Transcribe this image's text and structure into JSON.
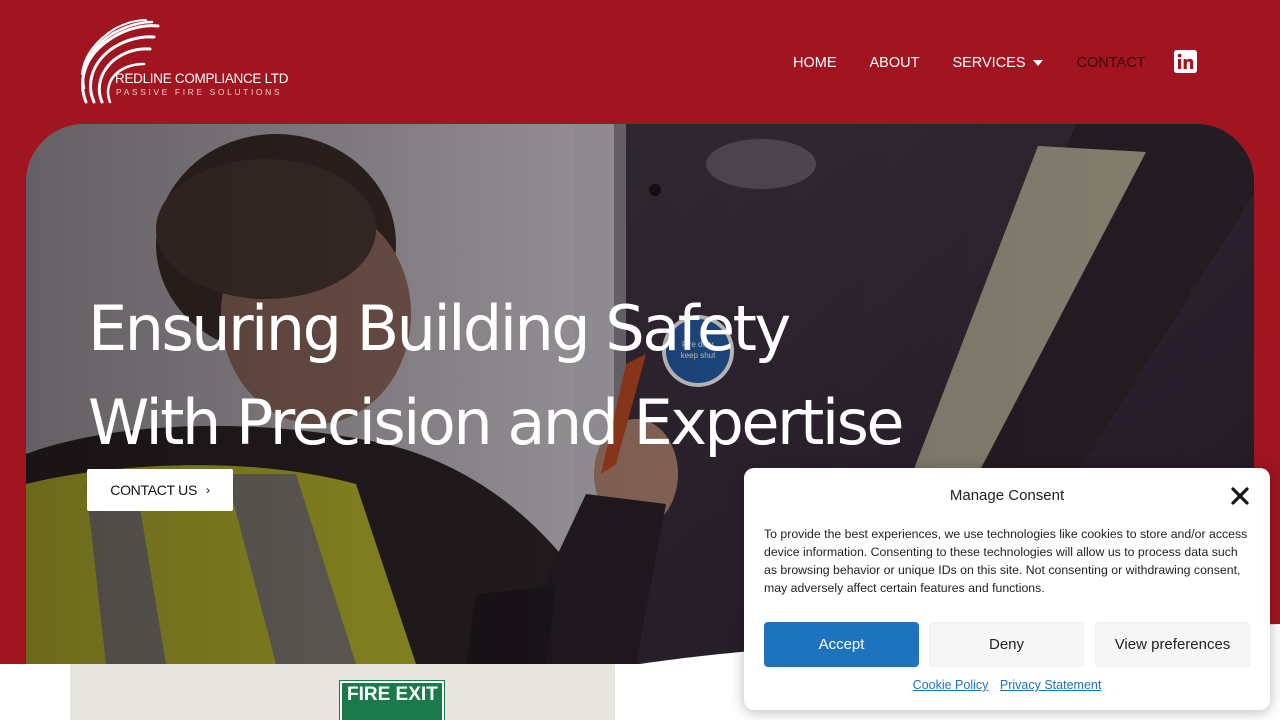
{
  "header": {
    "logo": {
      "name": "REDLINE COMPLIANCE LTD",
      "tagline": "PASSIVE FIRE SOLUTIONS"
    },
    "nav": {
      "home": "HOME",
      "about": "ABOUT",
      "services": "SERVICES",
      "contact": "CONTACT"
    },
    "social_icon": "linkedin-icon"
  },
  "hero": {
    "title_line1": "Ensuring Building Safety",
    "title_line2": "With Precision and Expertise",
    "cta_label": "CONTACT US",
    "cta_icon": "chevron-right-icon",
    "door_sign": "Fire door keep shut"
  },
  "below": {
    "sign_text": "FIRE EXIT"
  },
  "consent": {
    "title": "Manage Consent",
    "body": "To provide the best experiences, we use technologies like cookies to store and/or access device information. Consenting to these technologies will allow us to process data such as browsing behavior or unique IDs on this site. Not consenting or withdrawing consent, may adversely affect certain features and functions.",
    "accept": "Accept",
    "deny": "Deny",
    "view_preferences": "View preferences",
    "cookie_policy": "Cookie Policy",
    "privacy_statement": "Privacy Statement"
  },
  "colors": {
    "brand_red": "#a01520",
    "accept_blue": "#1e73be",
    "contact_nav": "#3a0a0e"
  }
}
